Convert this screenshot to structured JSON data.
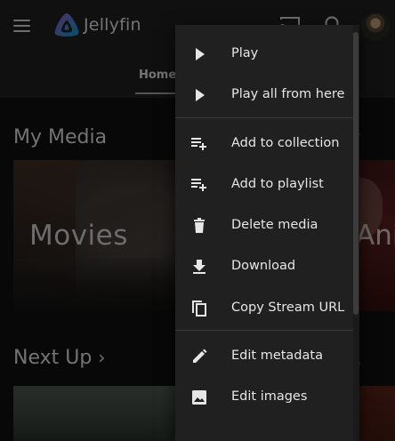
{
  "header": {
    "app_title": "Jellyfin",
    "tabs": [
      {
        "label": "Home"
      }
    ],
    "icons": [
      "menu-icon",
      "jellyfin-logo",
      "cast-icon",
      "search-icon",
      "avatar"
    ]
  },
  "sections": [
    {
      "title": "My Media",
      "cards": [
        {
          "label": "Movies"
        },
        {
          "label": "Anim"
        }
      ]
    },
    {
      "title": "Next Up",
      "title_suffix": "›"
    }
  ],
  "context_menu": {
    "items": [
      {
        "label": "Play",
        "icon": "play-icon"
      },
      {
        "label": "Play all from here",
        "icon": "play-icon"
      },
      {
        "label": "Add to collection",
        "icon": "playlist-add-icon"
      },
      {
        "label": "Add to playlist",
        "icon": "playlist-add-icon"
      },
      {
        "label": "Delete media",
        "icon": "delete-icon"
      },
      {
        "label": "Download",
        "icon": "download-icon"
      },
      {
        "label": "Copy Stream URL",
        "icon": "copy-icon"
      },
      {
        "label": "Edit metadata",
        "icon": "edit-icon"
      },
      {
        "label": "Edit images",
        "icon": "image-icon"
      }
    ]
  },
  "colors": {
    "background": "#101010",
    "header": "#202020",
    "menu_background": "#202020",
    "logo_purple": "#aa5cc3",
    "logo_blue": "#00a4dc"
  }
}
